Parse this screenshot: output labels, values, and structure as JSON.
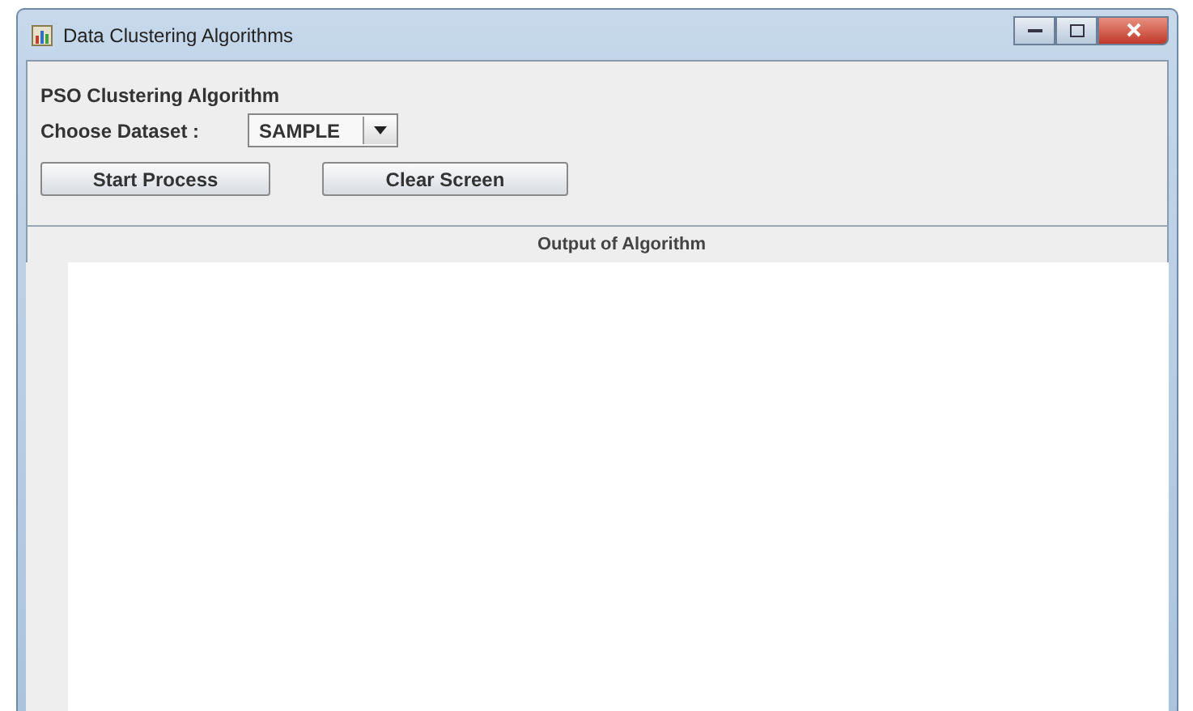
{
  "window": {
    "title": "Data Clustering Algorithms"
  },
  "heading": "PSO Clustering Algorithm",
  "dataset": {
    "label": "Choose Dataset :",
    "value": "SAMPLE"
  },
  "buttons": [
    {
      "label": "Start Process"
    },
    {
      "label": "Clear Screen"
    }
  ],
  "output": {
    "title": "Output of Algorithm"
  }
}
